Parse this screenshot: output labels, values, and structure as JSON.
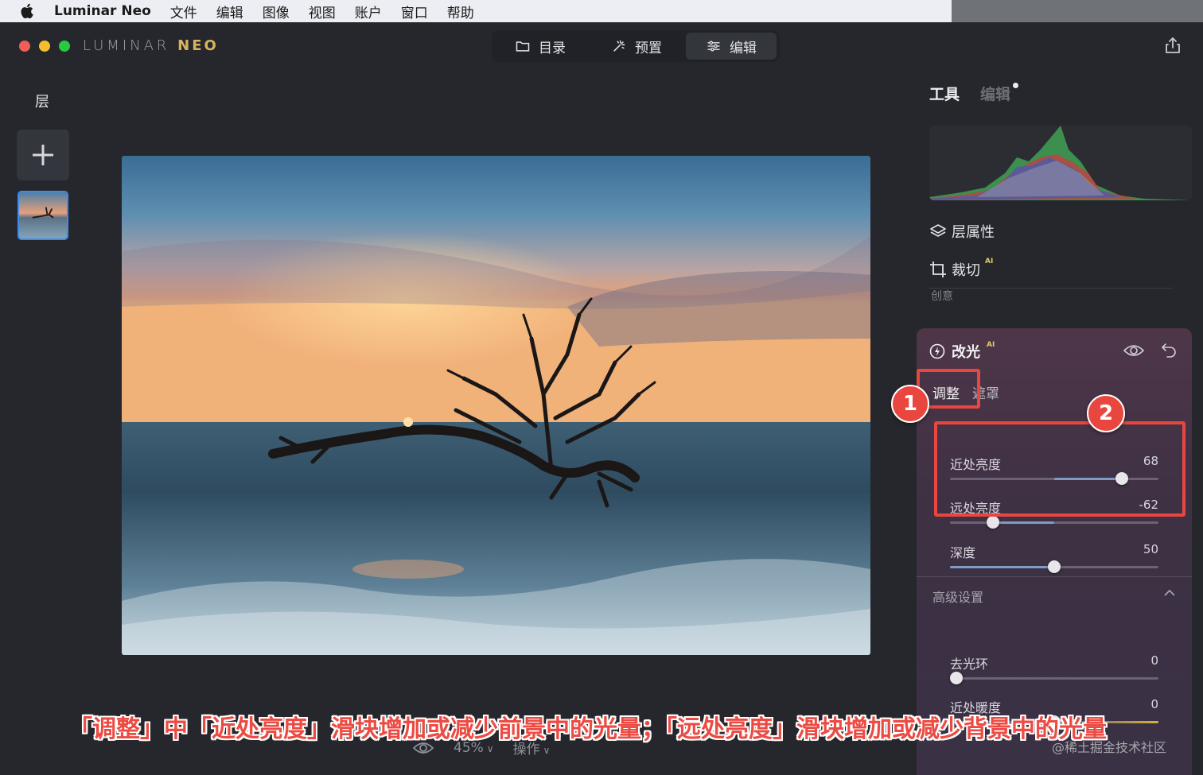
{
  "menubar": {
    "app_name": "Luminar Neo",
    "items": [
      "文件",
      "编辑",
      "图像",
      "视图",
      "账户",
      "窗口",
      "帮助"
    ]
  },
  "titlebar": {
    "logo_main": "LUMINAR",
    "logo_accent": "NEO",
    "modes": [
      {
        "label": "目录",
        "icon": "folder-icon"
      },
      {
        "label": "预置",
        "icon": "sparkle-icon"
      },
      {
        "label": "编辑",
        "icon": "sliders-icon",
        "active": true
      }
    ]
  },
  "layers": {
    "title": "层"
  },
  "bottom_bar": {
    "zoom": "45%",
    "actions_label": "操作"
  },
  "right_panel": {
    "tabs": {
      "tools": "工具",
      "edits": "编辑"
    },
    "layer_properties": "层属性",
    "crop": "裁切",
    "crop_ai": "AI",
    "section_creative": "创意",
    "relight": {
      "title": "改光",
      "ai": "AI",
      "sub_tabs": {
        "adjust": "调整",
        "mask": "遮罩"
      },
      "sliders": [
        {
          "label": "近处亮度",
          "value": "68",
          "fraction": 0.825,
          "fill_from": 0.5
        },
        {
          "label": "远处亮度",
          "value": "-62",
          "fraction": 0.205,
          "fill_from": 0.5
        },
        {
          "label": "深度",
          "value": "50",
          "fraction": 0.5,
          "fill_from": 0.0
        }
      ],
      "advanced_label": "高级设置",
      "advanced_sliders": [
        {
          "label": "去光环",
          "value": "0",
          "fraction": 0.03,
          "fill_from": 0.0
        },
        {
          "label": "近处暖度",
          "value": "0",
          "fraction": 0.5,
          "fill_from": 0.5
        }
      ]
    }
  },
  "annotations": {
    "badge_1": "1",
    "badge_2": "2",
    "caption": "「调整」中「近处亮度」滑块增加或减少前景中的光量；「远处亮度」滑块增加或减少背景中的光量",
    "watermark": "@稀土掘金技术社区"
  },
  "colors": {
    "accent_red": "#e8463f",
    "active_border": "#3c8bf0",
    "ai_badge": "#e6c96b"
  }
}
